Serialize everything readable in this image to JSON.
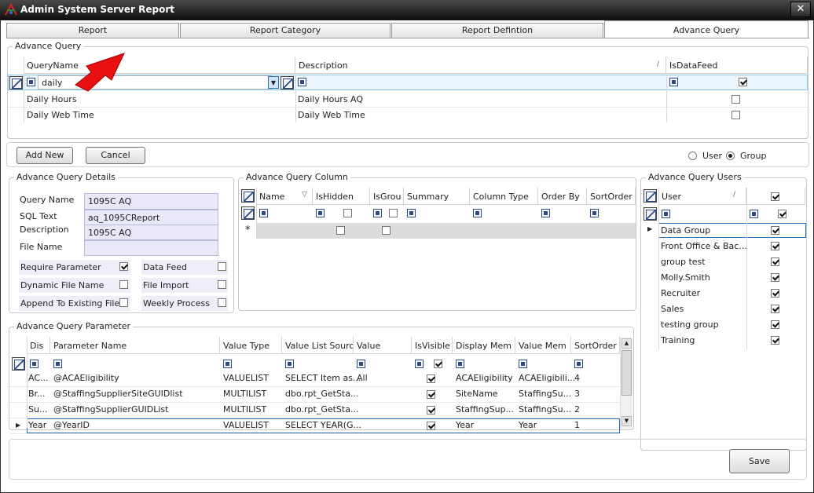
{
  "window": {
    "title": "Admin System Server Report",
    "close": "✕"
  },
  "tabs": [
    "Report",
    "Report Category",
    "Report Defintion",
    "Advance Query"
  ],
  "advance_query": {
    "group_label": "Advance Query",
    "columns": [
      "QueryName",
      "Description",
      "IsDataFeed"
    ],
    "filter_value": "daily",
    "rows": [
      {
        "name": "Daily Hours",
        "description": "Daily Hours AQ",
        "is_data_feed": false
      },
      {
        "name": "Daily Web Time",
        "description": "Daily Web Time",
        "is_data_feed": false
      }
    ]
  },
  "buttons": {
    "add_new": "Add New",
    "cancel": "Cancel",
    "save": "Save"
  },
  "mode": {
    "user": "User",
    "group": "Group",
    "selected": "Group"
  },
  "details": {
    "group_label": "Advance Query Details",
    "query_name_label": "Query  Name",
    "query_name": "1095C AQ",
    "sql_text_label": "SQL Text",
    "sql_text": "aq_1095CReport",
    "description_label": "Description",
    "description": "1095C AQ",
    "file_name_label": "File Name",
    "file_name": "",
    "require_parameter": "Require Parameter",
    "dynamic_file_name": "Dynamic File Name",
    "append_to_existing": "Append To Existing File",
    "data_feed": "Data Feed",
    "file_import": "File Import",
    "weekly_process": "Weekly Process"
  },
  "columns_panel": {
    "group_label": "Advance Query Column",
    "headers": [
      "Name",
      "IsHidden",
      "IsGrou",
      "Summary",
      "Column Type",
      "Order By",
      "SortOrder"
    ]
  },
  "users_panel": {
    "group_label": "Advance Query Users",
    "header": "User",
    "rows": [
      "Data Group",
      "Front Office & Bac...",
      "group test",
      "Molly.Smith",
      "Recruiter",
      "Sales",
      "testing group",
      "Training"
    ]
  },
  "parameters": {
    "group_label": "Advance Query Parameter",
    "headers": [
      "Dis",
      "Parameter Name",
      "Value Type",
      "Value List Sourc",
      "Value",
      "IsVisible",
      "Display Mem",
      "Value Mem",
      "SortOrder"
    ],
    "rows": [
      [
        "AC...",
        "@ACAEligibility",
        "VALUELIST",
        "SELECT Item as...",
        "All",
        true,
        "ACAEligibility",
        "ACAEligibili...",
        "4"
      ],
      [
        "Br...",
        "@StaffingSupplierSiteGUIDlist",
        "MULTILIST",
        "dbo.rpt_GetSta...",
        "",
        true,
        "SiteName",
        "StaffingSu...",
        "3"
      ],
      [
        "Su...",
        "@StaffingSupplierGUIDList",
        "MULTILIST",
        "dbo.rpt_GetSta...",
        "",
        true,
        "StaffingSup...",
        "StaffingSu...",
        "2"
      ],
      [
        "Year",
        "@YearID",
        "VALUELIST",
        "SELECT YEAR(G...",
        "",
        true,
        "Year",
        "Year",
        "1"
      ]
    ]
  }
}
